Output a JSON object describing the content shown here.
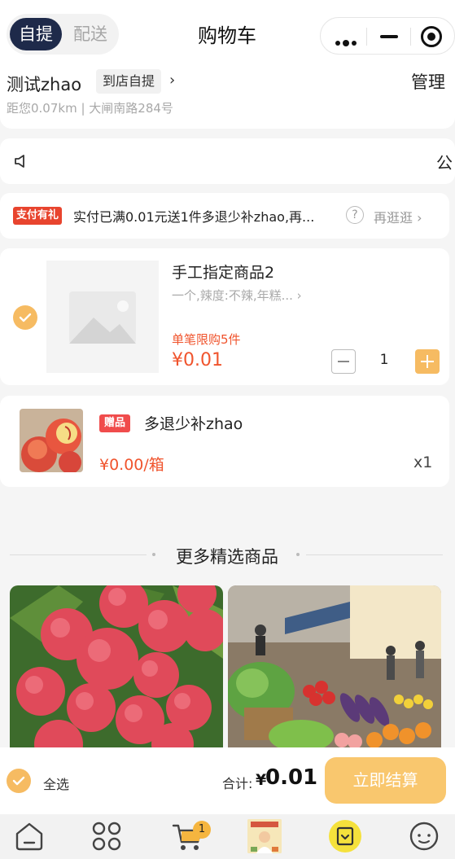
{
  "header": {
    "mode_active": "自提",
    "mode_inactive": "配送",
    "title": "购物车"
  },
  "store": {
    "name": "测试zhao",
    "pickup_tag": "到店自提",
    "chevron": "›",
    "manage": "管理",
    "address": "距您0.07km | 大闸南路284号"
  },
  "notice": {
    "icon": "speaker-icon",
    "text": "公"
  },
  "promo": {
    "tag": "支付有礼",
    "text": "实付已满0.01元送1件多退少补zhao,再...",
    "help": "?",
    "more": "再逛逛 ›"
  },
  "cart_item": {
    "name": "手工指定商品2",
    "spec": "一个,辣度:不辣,年糕... ›",
    "limit": "单笔限购5件",
    "price": "¥0.01",
    "quantity": "1"
  },
  "gift_item": {
    "tag": "赠品",
    "name": "多退少补zhao",
    "price": "¥0.00/箱",
    "quantity": "x1"
  },
  "more_section": {
    "title": "更多精选商品"
  },
  "checkout": {
    "select_all": "全选",
    "total_label": "合计:",
    "currency": "¥",
    "total": "0.01",
    "button": "立即结算"
  },
  "tabbar": {
    "cart_badge": "1",
    "items": [
      "home-icon",
      "category-icon",
      "cart-icon",
      "promo-thumbnail",
      "order-icon",
      "profile-icon"
    ]
  },
  "colors": {
    "accent": "#f6bb62",
    "price": "#f0542d",
    "mode_active_bg": "#1e2a4a",
    "checkout_button": "#f9c76e"
  }
}
